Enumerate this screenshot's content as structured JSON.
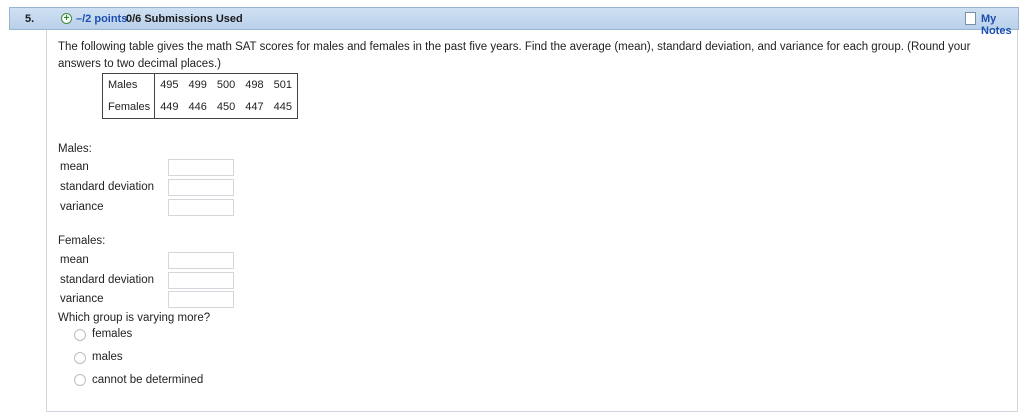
{
  "header": {
    "question_number": "5.",
    "points": "–/2 points",
    "submissions": "0/6 Submissions Used",
    "my_notes": "My Notes"
  },
  "question": {
    "text": "The following table gives the math SAT scores for males and females in the past five years. Find the average (mean), standard deviation, and variance for each group. (Round your answers to two decimal places.)"
  },
  "table": {
    "rows": [
      {
        "label": "Males",
        "values": [
          "495",
          "499",
          "500",
          "498",
          "501"
        ]
      },
      {
        "label": "Females",
        "values": [
          "449",
          "446",
          "450",
          "447",
          "445"
        ]
      }
    ]
  },
  "males": {
    "heading": "Males:",
    "fields": [
      {
        "label": "mean",
        "value": ""
      },
      {
        "label": "standard deviation",
        "value": ""
      },
      {
        "label": "variance",
        "value": ""
      }
    ]
  },
  "females": {
    "heading": "Females:",
    "fields": [
      {
        "label": "mean",
        "value": ""
      },
      {
        "label": "standard deviation",
        "value": ""
      },
      {
        "label": "variance",
        "value": ""
      }
    ]
  },
  "varying": {
    "question": "Which group is varying more?",
    "options": [
      "females",
      "males",
      "cannot be determined"
    ]
  }
}
